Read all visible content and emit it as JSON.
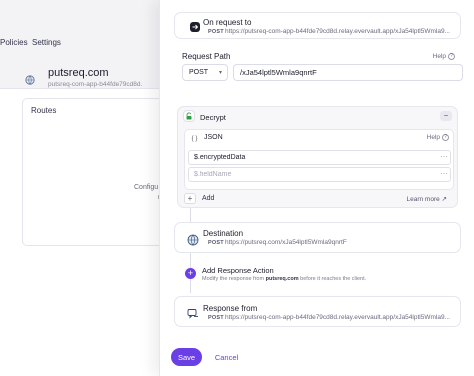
{
  "background": {
    "nav_tabs": [
      "Policies",
      "Settings"
    ],
    "site_name": "putsreq.com",
    "site_url": "putsreq-com-app-b44fde79cd8d.",
    "routes_title": "Routes",
    "routes_text": "Configu",
    "routes_text2": "r"
  },
  "trigger": {
    "title": "On request to",
    "method": "POST",
    "url": "https://putsreq-com-app-b44fde79cd8d.relay.evervault.app/xJa54lptl5Wmla9..."
  },
  "request_path": {
    "label": "Request Path",
    "help": "Help",
    "method_value": "POST",
    "path_value": "/xJa54lptl5Wmla9qnrtF"
  },
  "decrypt": {
    "title": "Decrypt",
    "format": "JSON",
    "help": "Help",
    "field_value": "$.encryptedData",
    "field_placeholder": "$.fieldName",
    "add_label": "Add",
    "learn_more": "Learn more"
  },
  "destination": {
    "title": "Destination",
    "method": "POST",
    "url": "https://putsreq.com/xJa54lptl5Wmla9qnrtF"
  },
  "response_action": {
    "title": "Add Response Action",
    "desc_prefix": "Modify the response from ",
    "desc_host": "putsreq.com",
    "desc_suffix": " before it reaches the client."
  },
  "response_from": {
    "title": "Response from",
    "method": "POST",
    "url": "https://putsreq-com-app-b44fde79cd8d.relay.evervault.app/xJa54lptl5Wmla9..."
  },
  "footer": {
    "save": "Save",
    "cancel": "Cancel"
  },
  "colors": {
    "accent": "#6b3fe6",
    "decrypt_icon": "#2ea043"
  }
}
